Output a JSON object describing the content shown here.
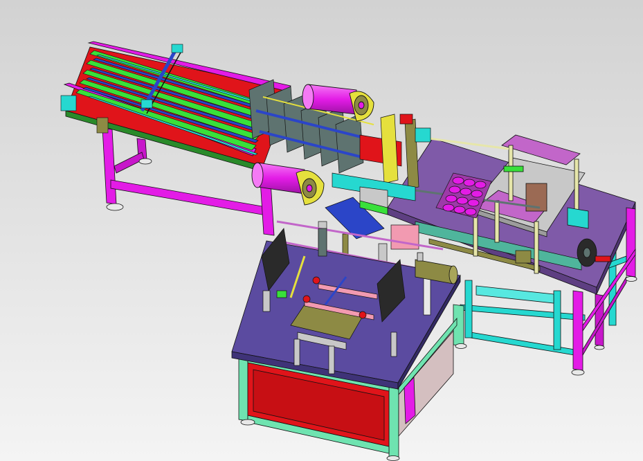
{
  "viewport": {
    "background_top": "#d2d2d2",
    "background_bottom": "#f4f4f4"
  },
  "model": {
    "palette": {
      "magenta_frame": "#e31ce6",
      "magenta_shadow": "#9d12a4",
      "cyan_frame": "#26d8d0",
      "mint_frame": "#6fe3b0",
      "purple_plate": "#7f5aa8",
      "purple_plate_dark": "#5e3f82",
      "blue_plate": "#5b4ba0",
      "red_panel": "#e0141a",
      "green_roller": "#39e03a",
      "blue_beam": "#2b45c8",
      "yellow_part": "#e5e03d",
      "olive_part": "#8d8a44",
      "slate_part": "#5e7370",
      "grey_plate": "#c8c8c8",
      "pink_block": "#f29ab1",
      "dark_part": "#2a2a2a",
      "edge": "#111111"
    },
    "components": [
      "infeed-conveyor",
      "magenta-stand",
      "roller-lanes",
      "guide-plates",
      "reel-upper",
      "reel-lower",
      "central-mechanism",
      "purple-table",
      "cyan-frame",
      "press-frame",
      "cup-tray",
      "front-table",
      "mint-frame",
      "red-enclosure",
      "front-fixture",
      "side-cylinder"
    ]
  }
}
